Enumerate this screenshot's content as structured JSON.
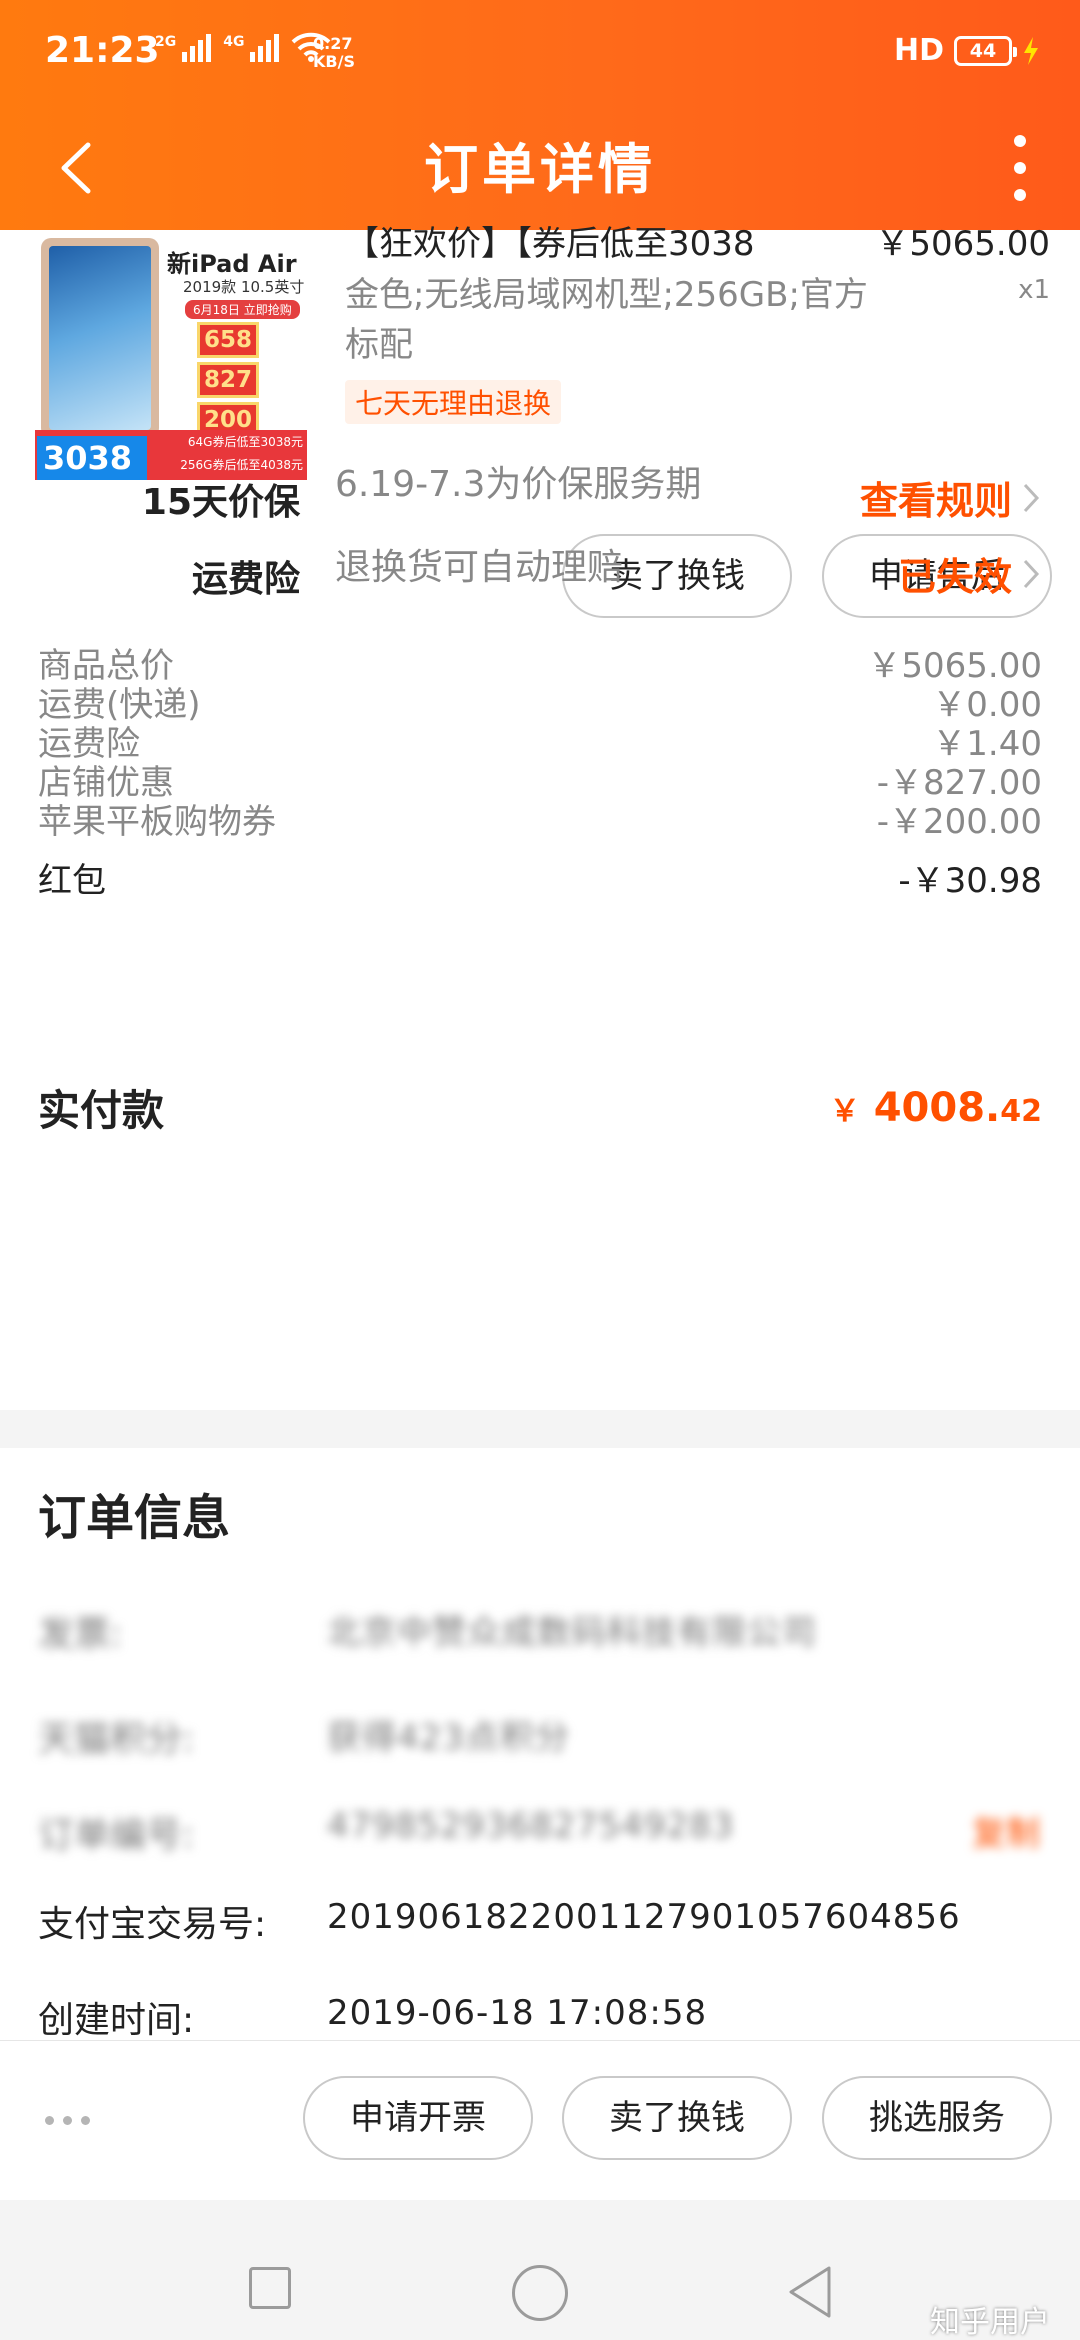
{
  "status_bar": {
    "time": "21:23",
    "signal_1": "2G",
    "signal_2": "4G",
    "speed_value": "0.27",
    "speed_unit": "KB/S",
    "hd": "HD",
    "battery": "44"
  },
  "header": {
    "title": "订单详情"
  },
  "product": {
    "thumb_name": "新iPad Air",
    "thumb_sub": "2019款 10.5英寸",
    "thumb_date": "6月18日 立即抢购",
    "thumb_coupons": [
      "658",
      "827",
      "200"
    ],
    "thumb_badge": "3038",
    "thumb_line_1": "64G券后低至3038元",
    "thumb_line_2": "256G券后低至4038元",
    "title": "【狂欢价】【券后低至3038",
    "price": "￥5065.00",
    "spec": "金色;无线局域网机型;256GB;官方标配",
    "qty": "x1",
    "tag": "七天无理由退换",
    "sell_button": "卖了换钱",
    "aftersale_button": "申请售后"
  },
  "services": [
    {
      "label": "15天价保",
      "desc": "6.19-7.3为价保服务期",
      "link": "查看规则"
    },
    {
      "label": "运费险",
      "desc": "退换货可自动理赔",
      "link": "已失效"
    }
  ],
  "fees": [
    {
      "label": "商品总价",
      "value": "￥5065.00"
    },
    {
      "label": "运费(快递)",
      "value": "￥0.00"
    },
    {
      "label": "运费险",
      "value": "￥1.40"
    },
    {
      "label": "店铺优惠",
      "value": "-￥827.00"
    },
    {
      "label": "苹果平板购物券",
      "value": "-￥200.00"
    },
    {
      "label": "红包",
      "value": "-￥30.98"
    }
  ],
  "total": {
    "label": "实付款",
    "currency": "￥",
    "integer": "4008.",
    "decimal": "42"
  },
  "order_info": {
    "title": "订单信息",
    "blurred_rows": [
      {
        "label": "发票:",
        "value": "北京中赞众成数码科技有限公司"
      },
      {
        "label": "天猫积分:",
        "value": "获得423点积分"
      },
      {
        "label": "订单编号:",
        "value": "479852936827549283"
      }
    ],
    "copy_label": "复制",
    "alipay_label": "支付宝交易号:",
    "alipay_value": "2019061822001127901057604856",
    "created_label": "创建时间:",
    "created_value": "2019-06-18 17:08:58"
  },
  "actions": {
    "invoice": "申请开票",
    "sell": "卖了换钱",
    "service": "挑选服务"
  },
  "watermark": "知乎用户",
  "colors": {
    "brand_orange": "#ff6a1a",
    "price_orange": "#ff5000"
  }
}
